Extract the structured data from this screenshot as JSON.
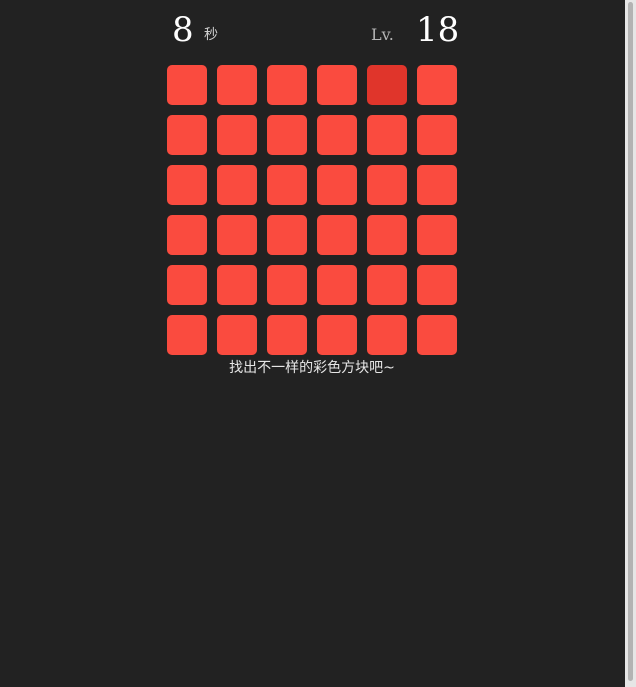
{
  "hud": {
    "time_value": "8",
    "time_unit": "秒",
    "level_label": "Lv.",
    "level_value": "18"
  },
  "board": {
    "rows": 6,
    "cols": 6,
    "base_color": "#fa4b3f",
    "odd_color": "#e0352b",
    "odd_tile": {
      "row": 1,
      "col": 5
    }
  },
  "hint_text": "找出不一样的彩色方块吧~",
  "colors": {
    "background": "#222222"
  }
}
